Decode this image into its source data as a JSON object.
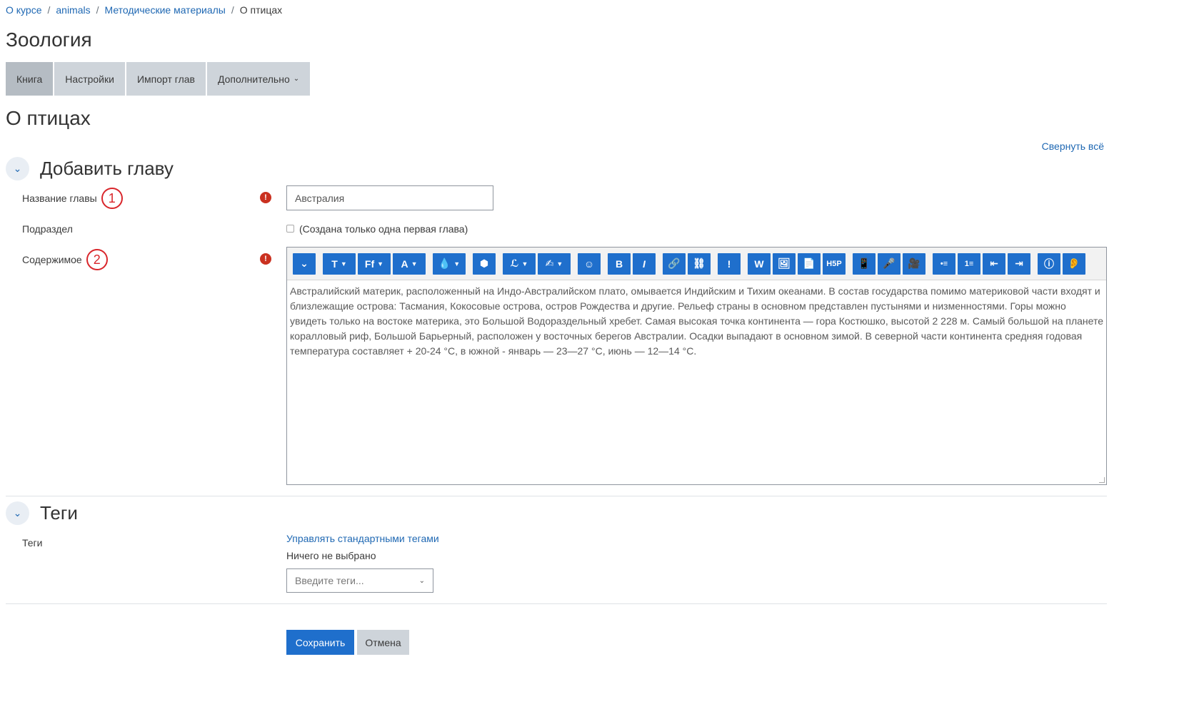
{
  "breadcrumb": {
    "items": [
      "О курсе",
      "animals",
      "Методические материалы"
    ],
    "current": "О птицах",
    "separator": "/"
  },
  "course_title": "Зоология",
  "tabs": [
    {
      "label": "Книга",
      "active": true
    },
    {
      "label": "Настройки"
    },
    {
      "label": "Импорт глав"
    },
    {
      "label": "Дополнительно"
    }
  ],
  "page_title": "О птицах",
  "collapse_all": "Свернуть всё",
  "section_add": {
    "title": "Добавить главу",
    "fields": {
      "chapter_title_label": "Название главы",
      "chapter_title_value": "Австралия",
      "subchapter_label": "Подраздел",
      "subchapter_note": "(Создана только одна первая глава)",
      "content_label": "Содержимое"
    },
    "annotations": [
      "1",
      "2"
    ],
    "required_mark": "!"
  },
  "editor": {
    "toolbar": [
      [
        "⌄"
      ],
      [
        "T",
        "Ff",
        "A"
      ],
      [
        "💧"
      ],
      [
        "⬢"
      ],
      [
        "ℒ",
        "✍"
      ],
      [
        "☺"
      ],
      [
        "B",
        "I"
      ],
      [
        "🔗",
        "⛓"
      ],
      [
        "!"
      ],
      [
        "W",
        "🖼",
        "📄",
        "H5P"
      ],
      [
        "📱",
        "🎤",
        "🎥"
      ],
      [
        "•≡",
        "1≡",
        "⇤",
        "⇥"
      ],
      [
        "ⓘ",
        "👂"
      ]
    ],
    "content": "Австралийский материк, расположенный на Индо-Австралийском плато, омывается Индийским и Тихим океанами. В состав государства помимо материковой части входят и близлежащие острова: Тасмания, Кокосовые острова, остров Рождества и другие. Рельеф страны в основном представлен пустынями и низменностями. Горы можно увидеть только на востоке материка, это Большой Водораздельный хребет. Самая высокая точка континента — гора Костюшко, высотой 2 228 м. Самый большой на планете коралловый риф, Большой Барьерный, расположен у восточных берегов Австралии. Осадки выпадают в основном зимой. В северной части континента средняя годовая температура составляет + 20-24 °С, в южной - январь — 23—27 °С, июнь — 12—14 °С."
  },
  "section_tags": {
    "title": "Теги",
    "label": "Теги",
    "manage_link": "Управлять стандартными тегами",
    "none_selected": "Ничего не выбрано",
    "input_placeholder": "Введите теги..."
  },
  "actions": {
    "save": "Сохранить",
    "cancel": "Отмена"
  },
  "colors": {
    "primary": "#1f6fcc",
    "link": "#1f68b3",
    "required": "#ca3120",
    "annotation": "#d9262b"
  }
}
